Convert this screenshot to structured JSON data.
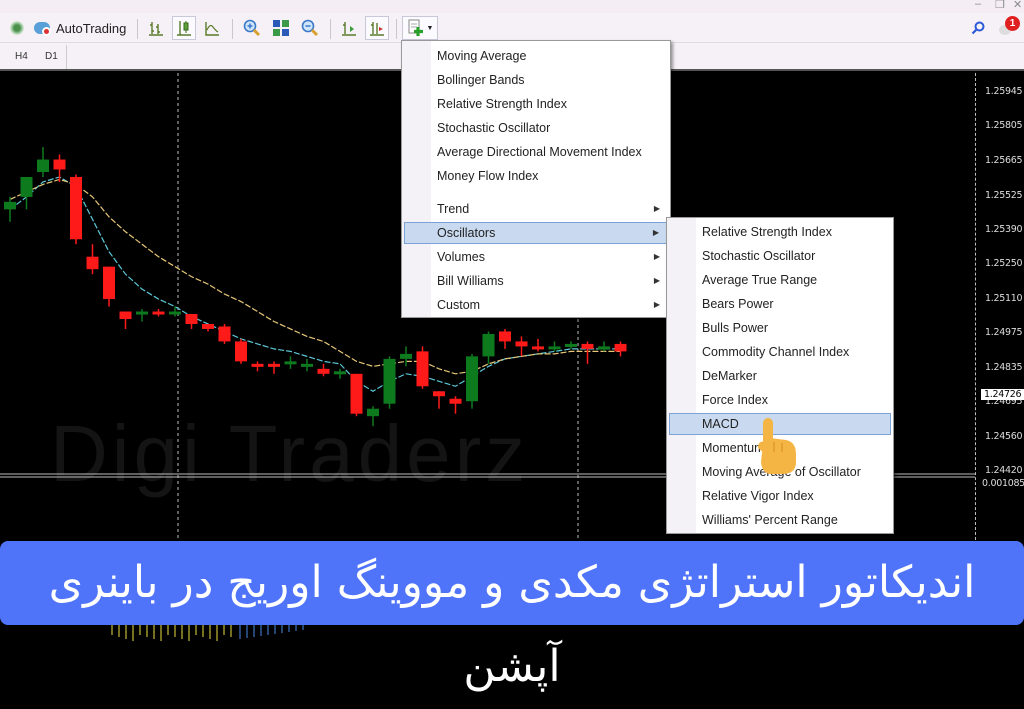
{
  "window": {
    "minimize": "–",
    "restore": "❐",
    "close": "✕"
  },
  "toolbar": {
    "autotrading_label": "AutoTrading",
    "buttons": [
      {
        "name": "signals-icon"
      },
      {
        "name": "autotrading-icon"
      },
      {
        "name": "bar-chart-icon"
      },
      {
        "name": "candlestick-chart-icon"
      },
      {
        "name": "line-chart-icon"
      },
      {
        "name": "zoom-in-icon"
      },
      {
        "name": "tile-windows-icon"
      },
      {
        "name": "zoom-out-icon"
      },
      {
        "name": "chart-shift-icon"
      },
      {
        "name": "autoscroll-icon"
      },
      {
        "name": "indicators-icon"
      }
    ],
    "notification_count": "1"
  },
  "timeframes": [
    "H4",
    "D1"
  ],
  "price_axis": {
    "labels": [
      "1.25945",
      "1.25805",
      "1.25665",
      "1.25525",
      "1.25390",
      "1.25250",
      "1.25110",
      "1.24975",
      "1.24835",
      "1.24695",
      "1.24560",
      "1.24420"
    ],
    "current_price": "1.24726",
    "macd_scale": "0.001085"
  },
  "watermark": "Digi Traderz",
  "indicators_menu": {
    "items": [
      {
        "label": "Moving Average",
        "submenu": false
      },
      {
        "label": "Bollinger Bands",
        "submenu": false
      },
      {
        "label": "Relative Strength Index",
        "submenu": false
      },
      {
        "label": "Stochastic Oscillator",
        "submenu": false
      },
      {
        "label": "Average Directional Movement Index",
        "submenu": false
      },
      {
        "label": "Money Flow Index",
        "submenu": false
      },
      {
        "label": "Trend",
        "submenu": true
      },
      {
        "label": "Oscillators",
        "submenu": true,
        "highlighted": true
      },
      {
        "label": "Volumes",
        "submenu": true
      },
      {
        "label": "Bill Williams",
        "submenu": true
      },
      {
        "label": "Custom",
        "submenu": true
      }
    ],
    "submenu_arrow": "▶"
  },
  "oscillators_submenu": {
    "items": [
      {
        "label": "Relative Strength Index"
      },
      {
        "label": "Stochastic Oscillator"
      },
      {
        "label": "Average True Range"
      },
      {
        "label": "Bears Power"
      },
      {
        "label": "Bulls Power"
      },
      {
        "label": "Commodity Channel Index"
      },
      {
        "label": "DeMarker"
      },
      {
        "label": "Force Index"
      },
      {
        "label": "MACD",
        "highlighted": true
      },
      {
        "label": "Momentum"
      },
      {
        "label": "Moving Average of Oscillator"
      },
      {
        "label": "Relative Vigor Index"
      },
      {
        "label": "Williams' Percent Range"
      }
    ]
  },
  "banner": {
    "text": "اندیکاتور استراتژی مکدی و مووینگ اوریج در باینری آپشن",
    "color": "#4f74fa"
  },
  "colors": {
    "bull": "#0e7a1e",
    "bear": "#ff1a1a",
    "ma_fast": "#5cc8d8",
    "ma_slow": "#e8c878",
    "menu_highlight": "#c9daf0"
  },
  "candles": [
    {
      "o": 1.2547,
      "h": 1.2552,
      "l": 1.2542,
      "c": 1.255
    },
    {
      "o": 1.2552,
      "h": 1.2556,
      "l": 1.2547,
      "c": 1.256
    },
    {
      "o": 1.2562,
      "h": 1.2572,
      "l": 1.256,
      "c": 1.2567
    },
    {
      "o": 1.2567,
      "h": 1.2569,
      "l": 1.2558,
      "c": 1.2563
    },
    {
      "o": 1.256,
      "h": 1.2561,
      "l": 1.2533,
      "c": 1.2535
    },
    {
      "o": 1.2528,
      "h": 1.2533,
      "l": 1.2521,
      "c": 1.2523
    },
    {
      "o": 1.2524,
      "h": 1.2524,
      "l": 1.2508,
      "c": 1.2511
    },
    {
      "o": 1.2506,
      "h": 1.2506,
      "l": 1.2499,
      "c": 1.2503
    },
    {
      "o": 1.2505,
      "h": 1.2507,
      "l": 1.2502,
      "c": 1.2506
    },
    {
      "o": 1.2506,
      "h": 1.2507,
      "l": 1.2504,
      "c": 1.2505
    },
    {
      "o": 1.2505,
      "h": 1.2508,
      "l": 1.2504,
      "c": 1.2506
    },
    {
      "o": 1.2505,
      "h": 1.2505,
      "l": 1.2499,
      "c": 1.2501
    },
    {
      "o": 1.2501,
      "h": 1.2501,
      "l": 1.2498,
      "c": 1.2499
    },
    {
      "o": 1.25,
      "h": 1.2501,
      "l": 1.2493,
      "c": 1.2494
    },
    {
      "o": 1.2494,
      "h": 1.2495,
      "l": 1.2485,
      "c": 1.2486
    },
    {
      "o": 1.2485,
      "h": 1.2486,
      "l": 1.2482,
      "c": 1.2484
    },
    {
      "o": 1.2485,
      "h": 1.2486,
      "l": 1.2481,
      "c": 1.2484
    },
    {
      "o": 1.2485,
      "h": 1.2488,
      "l": 1.2483,
      "c": 1.2486
    },
    {
      "o": 1.2484,
      "h": 1.2487,
      "l": 1.2482,
      "c": 1.2485
    },
    {
      "o": 1.2483,
      "h": 1.2485,
      "l": 1.248,
      "c": 1.2481
    },
    {
      "o": 1.2481,
      "h": 1.2483,
      "l": 1.2479,
      "c": 1.2482
    },
    {
      "o": 1.2481,
      "h": 1.2481,
      "l": 1.2464,
      "c": 1.2465
    },
    {
      "o": 1.2464,
      "h": 1.2468,
      "l": 1.246,
      "c": 1.2467
    },
    {
      "o": 1.2469,
      "h": 1.2488,
      "l": 1.2467,
      "c": 1.2487
    },
    {
      "o": 1.2487,
      "h": 1.2492,
      "l": 1.2484,
      "c": 1.2489
    },
    {
      "o": 1.249,
      "h": 1.2492,
      "l": 1.2475,
      "c": 1.2476
    },
    {
      "o": 1.2474,
      "h": 1.2474,
      "l": 1.2467,
      "c": 1.2472
    },
    {
      "o": 1.2471,
      "h": 1.2472,
      "l": 1.2465,
      "c": 1.2469
    },
    {
      "o": 1.247,
      "h": 1.2489,
      "l": 1.2467,
      "c": 1.2488
    },
    {
      "o": 1.2488,
      "h": 1.2498,
      "l": 1.2485,
      "c": 1.2497
    },
    {
      "o": 1.2498,
      "h": 1.2499,
      "l": 1.2491,
      "c": 1.2494
    },
    {
      "o": 1.2494,
      "h": 1.2496,
      "l": 1.2488,
      "c": 1.2492
    },
    {
      "o": 1.2492,
      "h": 1.2495,
      "l": 1.249,
      "c": 1.2491
    },
    {
      "o": 1.2491,
      "h": 1.2494,
      "l": 1.249,
      "c": 1.2492
    },
    {
      "o": 1.2492,
      "h": 1.2494,
      "l": 1.2491,
      "c": 1.2493
    },
    {
      "o": 1.2493,
      "h": 1.2494,
      "l": 1.2485,
      "c": 1.2491
    },
    {
      "o": 1.2491,
      "h": 1.2494,
      "l": 1.249,
      "c": 1.2492
    },
    {
      "o": 1.2493,
      "h": 1.2494,
      "l": 1.2488,
      "c": 1.249
    }
  ],
  "ma_fast": [
    1.2547,
    1.2552,
    1.2558,
    1.256,
    1.2556,
    1.2543,
    1.253,
    1.2521,
    1.2515,
    1.2511,
    1.2508,
    1.2504,
    1.2501,
    1.2498,
    1.2495,
    1.2493,
    1.2491,
    1.249,
    1.2488,
    1.2486,
    1.2485,
    1.2478,
    1.2474,
    1.2478,
    1.2481,
    1.248,
    1.2478,
    1.2476,
    1.248,
    1.2484,
    1.2487,
    1.2488,
    1.2489,
    1.249,
    1.2491,
    1.2491,
    1.2491,
    1.2491
  ],
  "ma_slow": [
    1.2551,
    1.2554,
    1.2557,
    1.2559,
    1.2557,
    1.2552,
    1.2544,
    1.2538,
    1.2533,
    1.2528,
    1.2524,
    1.252,
    1.2517,
    1.2513,
    1.251,
    1.2506,
    1.2502,
    1.2499,
    1.2496,
    1.2494,
    1.249,
    1.2486,
    1.2484,
    1.2485,
    1.2486,
    1.2486,
    1.2483,
    1.2481,
    1.2482,
    1.2485,
    1.2487,
    1.2488,
    1.2489,
    1.2489,
    1.249,
    1.249,
    1.249,
    1.249
  ]
}
